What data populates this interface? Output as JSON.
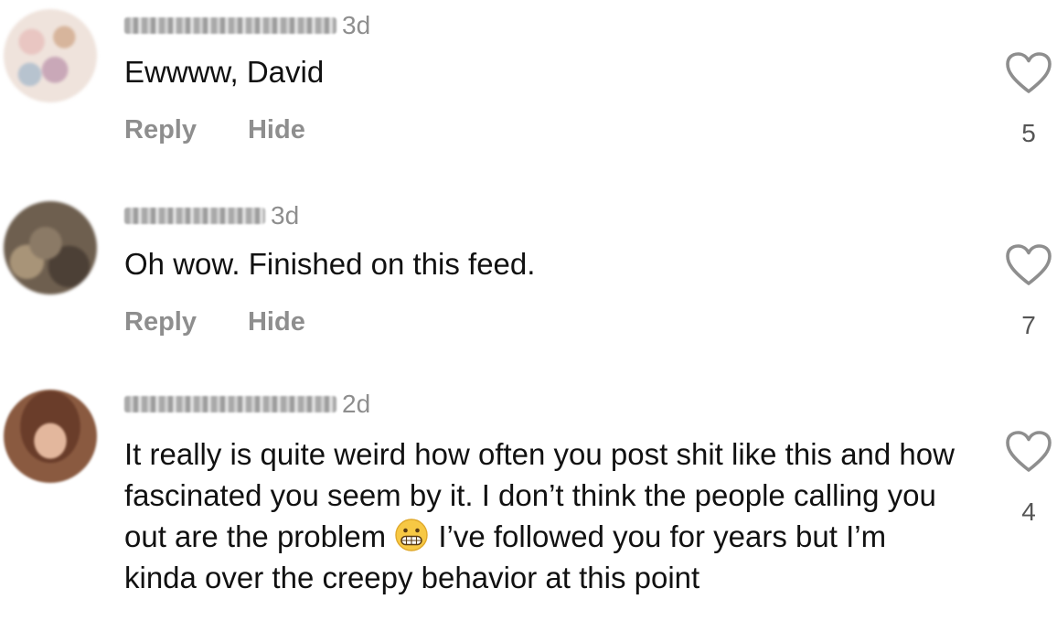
{
  "comments": [
    {
      "time": "3d",
      "text": "Ewwww, David",
      "reply_label": "Reply",
      "hide_label": "Hide",
      "likes": "5"
    },
    {
      "time": "3d",
      "text": "Oh wow. Finished on this feed.",
      "reply_label": "Reply",
      "hide_label": "Hide",
      "likes": "7"
    },
    {
      "time": "2d",
      "text_part1": "It really is quite weird how often you post shit like this and how fascinated you seem by it. I don’t think the people calling you out are the problem",
      "text_part2": "I’ve followed you for years but I’m kinda over the creepy behavior at this point",
      "emoji": "grimacing-face-emoji",
      "likes": "4"
    }
  ],
  "icons": {
    "like": "heart-outline-icon"
  },
  "colors": {
    "text": "#111111",
    "secondary": "#8e8e8e",
    "like_count": "#555555",
    "background": "#ffffff"
  }
}
